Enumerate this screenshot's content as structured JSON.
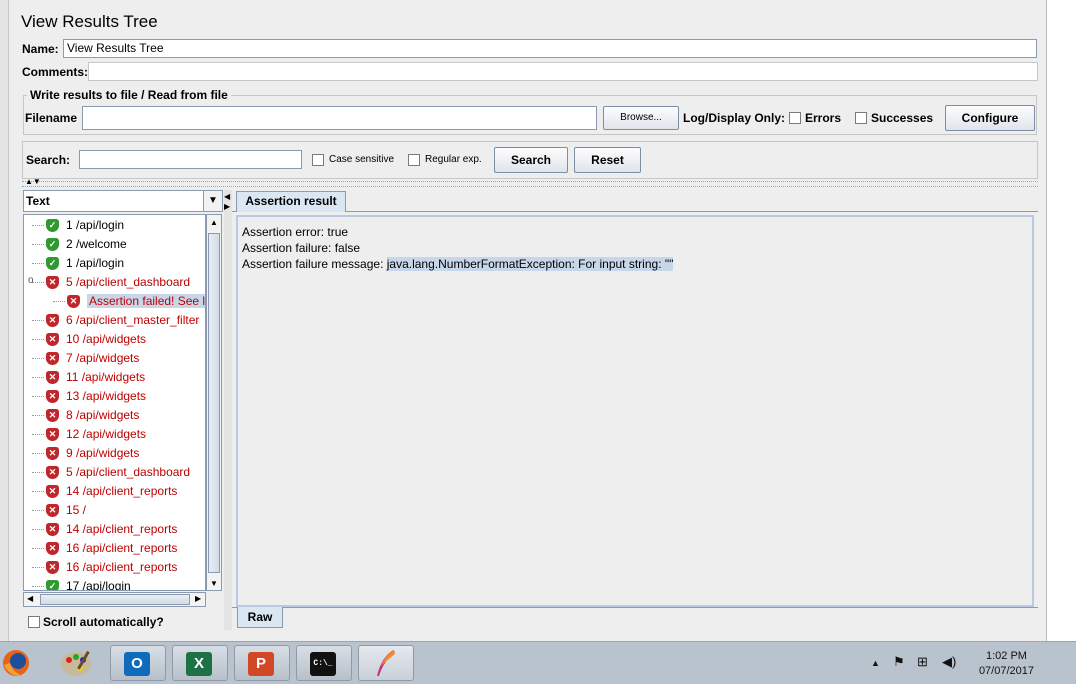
{
  "window": {
    "title": "View Results Tree"
  },
  "form": {
    "name_label": "Name:",
    "name_value": "View Results Tree",
    "comments_label": "Comments:"
  },
  "file_group": {
    "title": "Write results to file / Read from file",
    "filename_label": "Filename",
    "browse_label": "Browse...",
    "log_display_label": "Log/Display Only:",
    "errors_label": "Errors",
    "successes_label": "Successes",
    "configure_label": "Configure"
  },
  "search": {
    "label": "Search:",
    "case_sensitive_label": "Case sensitive",
    "regular_exp_label": "Regular exp.",
    "search_button": "Search",
    "reset_button": "Reset"
  },
  "tree": {
    "renderer_selected": "Text",
    "items": [
      {
        "label": "1 /api/login",
        "status": "success",
        "indent": 0
      },
      {
        "label": "2 /welcome",
        "status": "success",
        "indent": 0
      },
      {
        "label": "1 /api/login",
        "status": "success",
        "indent": 0
      },
      {
        "label": "5 /api/client_dashboard",
        "status": "failure",
        "indent": 0,
        "expanded": true
      },
      {
        "label": "Assertion failed! See l",
        "status": "failure",
        "indent": 1,
        "selected": true
      },
      {
        "label": "6 /api/client_master_filter",
        "status": "failure",
        "indent": 0
      },
      {
        "label": "10 /api/widgets",
        "status": "failure",
        "indent": 0
      },
      {
        "label": "7 /api/widgets",
        "status": "failure",
        "indent": 0
      },
      {
        "label": "11 /api/widgets",
        "status": "failure",
        "indent": 0
      },
      {
        "label": "13 /api/widgets",
        "status": "failure",
        "indent": 0
      },
      {
        "label": "8 /api/widgets",
        "status": "failure",
        "indent": 0
      },
      {
        "label": "12 /api/widgets",
        "status": "failure",
        "indent": 0
      },
      {
        "label": "9 /api/widgets",
        "status": "failure",
        "indent": 0
      },
      {
        "label": "5 /api/client_dashboard",
        "status": "failure",
        "indent": 0
      },
      {
        "label": "14 /api/client_reports",
        "status": "failure",
        "indent": 0
      },
      {
        "label": "15 /",
        "status": "failure",
        "indent": 0
      },
      {
        "label": "14 /api/client_reports",
        "status": "failure",
        "indent": 0
      },
      {
        "label": "16 /api/client_reports",
        "status": "failure",
        "indent": 0
      },
      {
        "label": "16 /api/client_reports",
        "status": "failure",
        "indent": 0
      },
      {
        "label": "17 /api/login",
        "status": "success",
        "indent": 0
      }
    ],
    "scroll_auto_label": "Scroll automatically?"
  },
  "result": {
    "tab_label": "Assertion result",
    "lines": {
      "error": "Assertion error: true",
      "failure": "Assertion failure: false",
      "message_prefix": "Assertion failure message: ",
      "message_value": "java.lang.NumberFormatException: For input string: \"\""
    },
    "raw_tab_label": "Raw"
  },
  "taskbar": {
    "apps": [
      {
        "name": "firefox-icon"
      },
      {
        "name": "paint-icon"
      },
      {
        "name": "outlook-icon",
        "glyph": "O"
      },
      {
        "name": "excel-icon",
        "glyph": "X"
      },
      {
        "name": "powerpoint-icon",
        "glyph": "P"
      },
      {
        "name": "cmd-icon",
        "glyph": "C:\\_"
      },
      {
        "name": "feather-icon"
      }
    ],
    "time": "1:02 PM",
    "date": "07/07/2017"
  },
  "colors": {
    "success": "#2f9a2f",
    "failure": "#c0272d",
    "failure_text": "#c00000",
    "selection": "#c8d6ea"
  }
}
